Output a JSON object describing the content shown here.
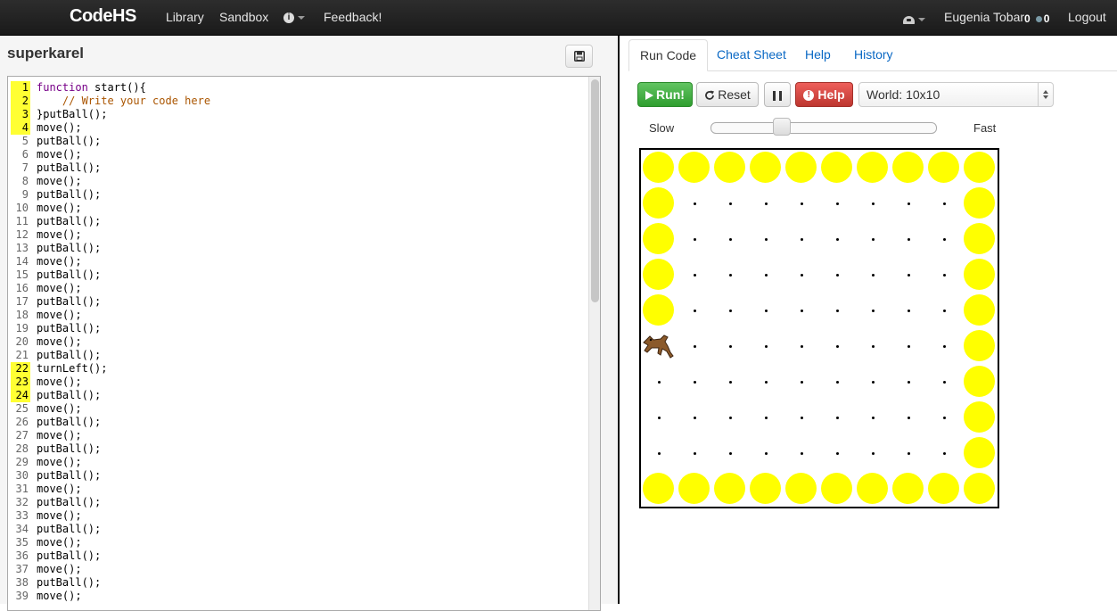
{
  "navbar": {
    "brand": "CodeHS",
    "links": [
      "Library",
      "Sandbox"
    ],
    "info_icon": "i",
    "feedback": "Feedback!",
    "user_name": "Eugenia Tobar",
    "points": "0",
    "gems": "0",
    "logout": "Logout"
  },
  "editor": {
    "file_title": "superkarel",
    "highlighted_lines": [
      1,
      2,
      3,
      4,
      22,
      23,
      24
    ],
    "lines": [
      "function start(){",
      "    // Write your code here",
      "}putBall();",
      "move();",
      "putBall();",
      "move();",
      "putBall();",
      "move();",
      "putBall();",
      "move();",
      "putBall();",
      "move();",
      "putBall();",
      "move();",
      "putBall();",
      "move();",
      "putBall();",
      "move();",
      "putBall();",
      "move();",
      "putBall();",
      "turnLeft();",
      "move();",
      "putBall();",
      "move();",
      "putBall();",
      "move();",
      "putBall();",
      "move();",
      "putBall();",
      "move();",
      "putBall();",
      "move();",
      "putBall();",
      "move();",
      "putBall();",
      "move();",
      "putBall();",
      "move();"
    ]
  },
  "tabs": [
    "Run Code",
    "Cheat Sheet",
    "Help",
    "History"
  ],
  "controls": {
    "run_label": "Run!",
    "reset_label": "Reset",
    "help_label": "Help",
    "help_icon": "!",
    "world_select": "World: 10x10",
    "slow_label": "Slow",
    "fast_label": "Fast",
    "speed_fraction": 0.3
  },
  "world": {
    "size": 10,
    "ball_color": "#ffff00",
    "karel": {
      "col": 0,
      "row": 5
    },
    "balls": [
      [
        0,
        0
      ],
      [
        1,
        0
      ],
      [
        2,
        0
      ],
      [
        3,
        0
      ],
      [
        4,
        0
      ],
      [
        5,
        0
      ],
      [
        6,
        0
      ],
      [
        7,
        0
      ],
      [
        8,
        0
      ],
      [
        9,
        0
      ],
      [
        0,
        1
      ],
      [
        0,
        2
      ],
      [
        0,
        3
      ],
      [
        0,
        4
      ],
      [
        9,
        1
      ],
      [
        9,
        2
      ],
      [
        9,
        3
      ],
      [
        9,
        4
      ],
      [
        9,
        5
      ],
      [
        9,
        6
      ],
      [
        9,
        7
      ],
      [
        9,
        8
      ],
      [
        0,
        9
      ],
      [
        1,
        9
      ],
      [
        2,
        9
      ],
      [
        3,
        9
      ],
      [
        4,
        9
      ],
      [
        5,
        9
      ],
      [
        6,
        9
      ],
      [
        7,
        9
      ],
      [
        8,
        9
      ],
      [
        9,
        9
      ]
    ]
  }
}
